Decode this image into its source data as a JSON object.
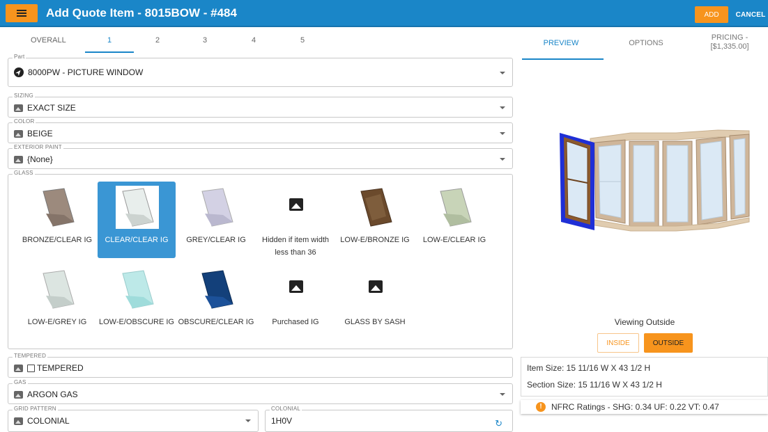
{
  "header": {
    "title": "Add Quote Item - 8015BOW - #484",
    "add_label": "ADD",
    "cancel_label": "CANCEL"
  },
  "left_tabs": [
    {
      "label": "OVERALL"
    },
    {
      "label": "1"
    },
    {
      "label": "2"
    },
    {
      "label": "3"
    },
    {
      "label": "4"
    },
    {
      "label": "5"
    }
  ],
  "part": {
    "label": "Part",
    "value": "8000PW - PICTURE WINDOW",
    "icon": "compass-icon"
  },
  "sizing": {
    "label": "SIZING",
    "value": "EXACT SIZE"
  },
  "color": {
    "label": "COLOR",
    "value": "BEIGE"
  },
  "exterior_paint": {
    "label": "EXTERIOR PAINT",
    "value": "{None}"
  },
  "glass": {
    "label": "GLASS",
    "selected": "CLEAR/CLEAR IG",
    "options": [
      {
        "label": "BRONZE/CLEAR IG"
      },
      {
        "label": "CLEAR/CLEAR IG"
      },
      {
        "label": "GREY/CLEAR IG"
      },
      {
        "label": "Hidden if item width less than 36"
      },
      {
        "label": "LOW-E/BRONZE IG"
      },
      {
        "label": "LOW-E/CLEAR IG"
      },
      {
        "label": "LOW-E/GREY IG"
      },
      {
        "label": "LOW-E/OBSCURE IG"
      },
      {
        "label": "OBSCURE/CLEAR IG"
      },
      {
        "label": "Purchased IG"
      },
      {
        "label": "GLASS BY SASH"
      }
    ]
  },
  "tempered": {
    "label": "TEMPERED",
    "value": "TEMPERED",
    "checked": false
  },
  "gas": {
    "label": "GAS",
    "value": "ARGON GAS"
  },
  "grid_pattern": {
    "label": "GRID PATTERN",
    "value": "COLONIAL"
  },
  "colonial": {
    "label": "COLONIAL",
    "value": "1H0V"
  },
  "right_tabs": [
    {
      "label": "PREVIEW"
    },
    {
      "label": "OPTIONS"
    },
    {
      "label": "PRICING - [$1,335.00]"
    }
  ],
  "preview": {
    "viewing_text": "Viewing Outside",
    "inside_label": "INSIDE",
    "outside_label": "OUTSIDE",
    "item_size": "Item Size: 15 11/16 W X 43 1/2 H",
    "section_size": "Section Size: 15 11/16 W X 43 1/2 H",
    "nfrc": "NFRC Ratings - SHG: 0.34 UF: 0.22 VT: 0.47"
  },
  "colors": {
    "brand_blue": "#1a86c8",
    "accent_orange": "#f7941d"
  }
}
